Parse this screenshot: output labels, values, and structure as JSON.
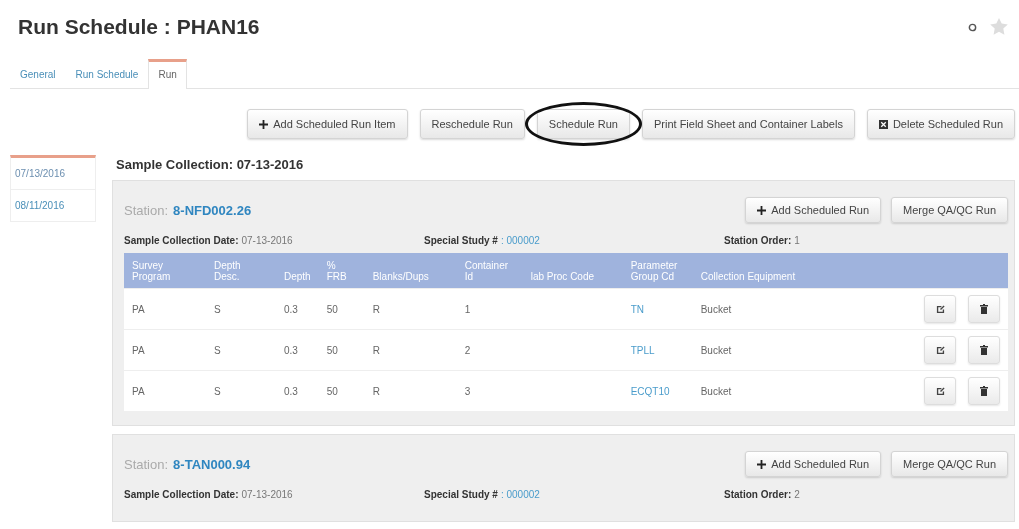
{
  "title": "Run Schedule : PHAN16",
  "tabs": [
    {
      "label": "General",
      "selected": false
    },
    {
      "label": "Run Schedule",
      "selected": false
    },
    {
      "label": "Run",
      "selected": true
    }
  ],
  "toolbar": [
    {
      "label": "Add Scheduled Run Item",
      "kind": "add",
      "circled": false
    },
    {
      "label": "Reschedule Run",
      "kind": "plain",
      "circled": false
    },
    {
      "label": "Schedule Run",
      "kind": "plain",
      "circled": true
    },
    {
      "label": "Print Field Sheet and Container Labels",
      "kind": "plain",
      "circled": false
    },
    {
      "label": "Delete Scheduled Run",
      "kind": "delete",
      "circled": false
    }
  ],
  "dates": [
    {
      "label": "07/13/2016",
      "selected": true
    },
    {
      "label": "08/11/2016",
      "selected": false
    }
  ],
  "section_title": "Sample Collection: 07-13-2016",
  "stations": [
    {
      "label": "Station:",
      "id": "8-NFD002.26",
      "date_label": "Sample Collection Date:",
      "date": "07-13-2016",
      "study_label": "Special Study #",
      "study": ": 000002",
      "order_label": "Station Order:",
      "order": "1",
      "buttons": [
        {
          "label": "Add Scheduled Run",
          "kind": "add"
        },
        {
          "label": "Merge QA/QC Run",
          "kind": "plain"
        }
      ],
      "table": {
        "columns": [
          "Survey Program",
          "Depth Desc.",
          "Depth",
          "% FRB",
          "Blanks/Dups",
          "Container Id",
          "lab Proc Code",
          "Parameter Group Cd",
          "Collection Equipment"
        ],
        "rows": [
          [
            "PA",
            "S",
            "0.3",
            "50",
            "R",
            "1",
            "",
            {
              "text": "TN",
              "kind": "link"
            },
            "Bucket"
          ],
          [
            "PA",
            "S",
            "0.3",
            "50",
            "R",
            "2",
            "",
            {
              "text": "TPLL",
              "kind": "link"
            },
            "Bucket"
          ],
          [
            "PA",
            "S",
            "0.3",
            "50",
            "R",
            "3",
            "",
            {
              "text": "ECQT10",
              "kind": "link"
            },
            "Bucket"
          ]
        ]
      }
    },
    {
      "label": "Station:",
      "id": "8-TAN000.94",
      "date_label": "Sample Collection Date:",
      "date": "07-13-2016",
      "study_label": "Special Study #",
      "study": ": 000002",
      "order_label": "Station Order:",
      "order": "2",
      "buttons": [
        {
          "label": "Add Scheduled Run",
          "kind": "add"
        },
        {
          "label": "Merge QA/QC Run",
          "kind": "plain"
        }
      ]
    }
  ]
}
